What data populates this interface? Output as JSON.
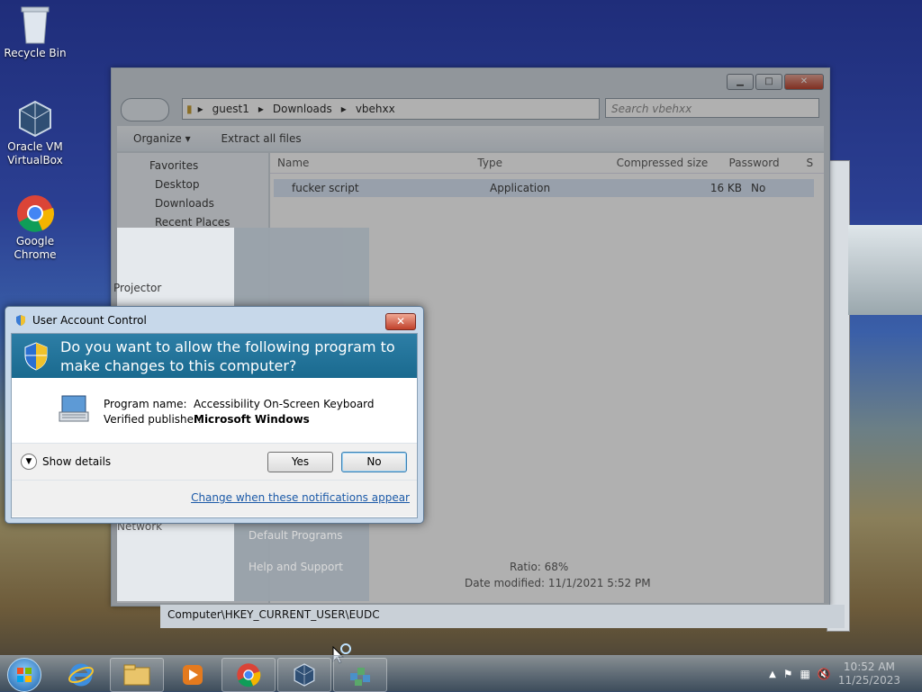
{
  "desktop": {
    "icons": [
      {
        "label": "Recycle Bin",
        "icon": "recycle-bin-icon"
      },
      {
        "label": "Oracle VM VirtualBox",
        "icon": "virtualbox-icon"
      },
      {
        "label": "Google Chrome",
        "icon": "chrome-icon"
      }
    ]
  },
  "explorer": {
    "breadcrumb": [
      "guest1",
      "Downloads",
      "vbehxx"
    ],
    "search_placeholder": "Search vbehxx",
    "toolbar": {
      "organize": "Organize ▾",
      "extract": "Extract all files"
    },
    "nav": [
      "Favorites",
      "Desktop",
      "Downloads",
      "Recent Places"
    ],
    "columns": [
      "Name",
      "Type",
      "Compressed size",
      "Password",
      "S"
    ],
    "file": {
      "name": "fucker script",
      "type": "Application",
      "size": "16 KB",
      "password": "No"
    },
    "status": {
      "ratio": "Ratio: 68%",
      "modified": "Date modified: 11/1/2021 5:52 PM"
    }
  },
  "start_remnant": {
    "item1": "Projector",
    "item2": "Default Programs",
    "item3": "Help and Support",
    "item4": "Network"
  },
  "regedit_status": "Computer\\HKEY_CURRENT_USER\\EUDC",
  "uac": {
    "title": "User Account Control",
    "question": "Do you want to allow the following program to make changes to this computer?",
    "program_name_label": "Program name:",
    "program_name": "Accessibility On-Screen Keyboard",
    "publisher_label": "Verified publisher:",
    "publisher": "Microsoft Windows",
    "show_details": "Show details",
    "yes": "Yes",
    "no": "No",
    "change_link": "Change when these notifications appear"
  },
  "taskbar": {
    "buttons": [
      "start-orb",
      "internet-explorer-icon",
      "explorer-icon",
      "media-player-icon",
      "chrome-icon",
      "virtualbox-icon",
      "on-screen-keyboard-icon"
    ],
    "time": "10:52 AM",
    "date": "11/25/2023"
  }
}
